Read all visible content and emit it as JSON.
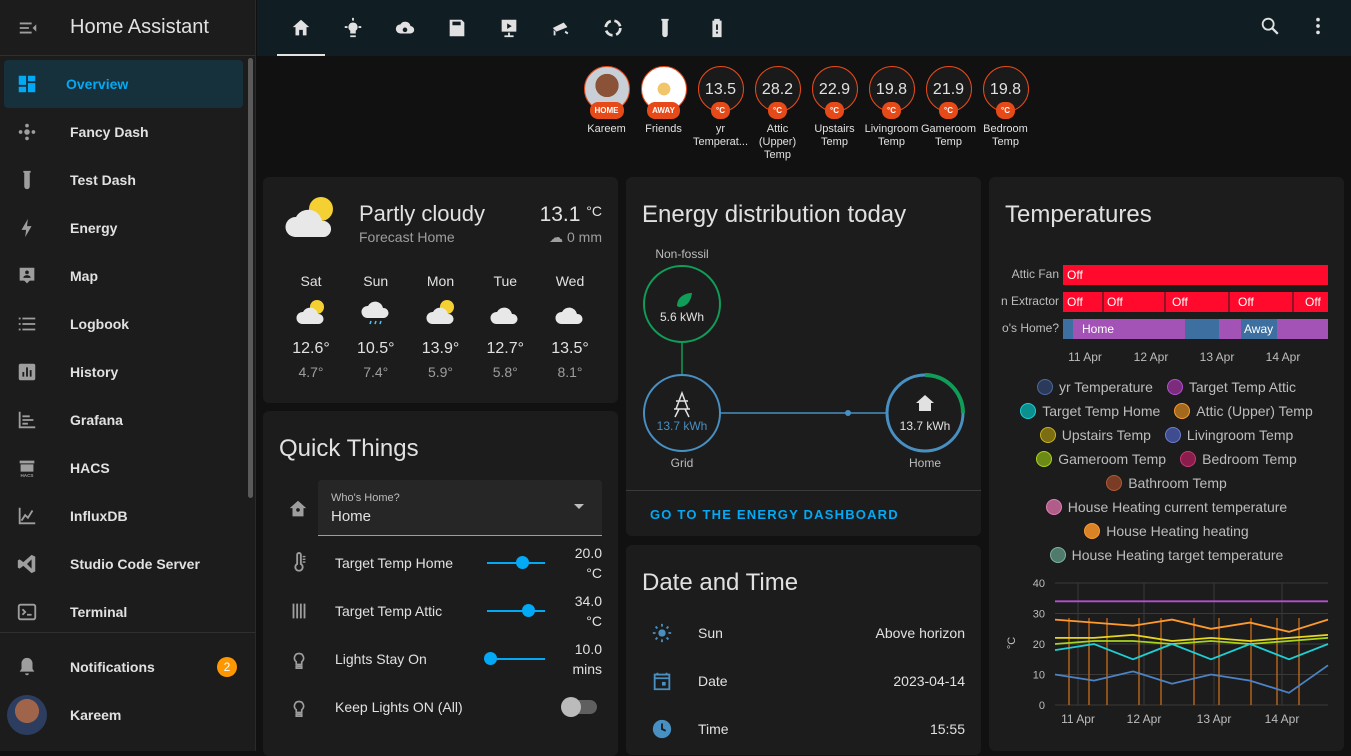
{
  "app": {
    "title": "Home Assistant"
  },
  "sidebar": {
    "items": [
      {
        "label": "Overview",
        "icon": "dashboard-icon"
      },
      {
        "label": "Fancy Dash",
        "icon": "fancy-dash-icon"
      },
      {
        "label": "Test Dash",
        "icon": "test-tube-icon"
      },
      {
        "label": "Energy",
        "icon": "lightning-icon"
      },
      {
        "label": "Map",
        "icon": "map-icon"
      },
      {
        "label": "Logbook",
        "icon": "logbook-icon"
      },
      {
        "label": "History",
        "icon": "history-icon"
      },
      {
        "label": "Grafana",
        "icon": "grafana-icon"
      },
      {
        "label": "HACS",
        "icon": "hacs-icon"
      },
      {
        "label": "InfluxDB",
        "icon": "influxdb-icon"
      },
      {
        "label": "Studio Code Server",
        "icon": "vscode-icon"
      },
      {
        "label": "Terminal",
        "icon": "terminal-icon"
      }
    ],
    "notifications": {
      "label": "Notifications",
      "count": "2"
    },
    "user": {
      "label": "Kareem"
    },
    "hacs_icon_text": "HACS"
  },
  "badges": [
    {
      "name": "Kareem",
      "tag": "HOME",
      "kind": "person"
    },
    {
      "name": "Friends",
      "tag": "AWAY",
      "kind": "group"
    },
    {
      "value": "13.5",
      "unit": "°C",
      "name": "yr Temperat..."
    },
    {
      "value": "28.2",
      "unit": "°C",
      "name": "Attic (Upper) Temp"
    },
    {
      "value": "22.9",
      "unit": "°C",
      "name": "Upstairs Temp"
    },
    {
      "value": "19.8",
      "unit": "°C",
      "name": "Livingroom Temp"
    },
    {
      "value": "21.9",
      "unit": "°C",
      "name": "Gameroom Temp"
    },
    {
      "value": "19.8",
      "unit": "°C",
      "name": "Bedroom Temp"
    }
  ],
  "weather": {
    "condition": "Partly cloudy",
    "subtitle": "Forecast Home",
    "temp": "13.1",
    "unit": "°C",
    "precip": "0 mm",
    "forecast": [
      {
        "day": "Sat",
        "hi": "12.6°",
        "lo": "4.7°",
        "icon": "partly-cloudy-icon"
      },
      {
        "day": "Sun",
        "hi": "10.5°",
        "lo": "7.4°",
        "icon": "rainy-icon"
      },
      {
        "day": "Mon",
        "hi": "13.9°",
        "lo": "5.9°",
        "icon": "partly-cloudy-icon"
      },
      {
        "day": "Tue",
        "hi": "12.7°",
        "lo": "5.8°",
        "icon": "cloudy-icon"
      },
      {
        "day": "Wed",
        "hi": "13.5°",
        "lo": "8.1°",
        "icon": "cloudy-icon"
      }
    ]
  },
  "quick": {
    "title": "Quick Things",
    "whos_home": {
      "label": "Who's Home?",
      "value": "Home"
    },
    "rows": [
      {
        "label": "Target Temp Home",
        "value_line1": "20.0",
        "value_line2": "°C",
        "level": 0.6
      },
      {
        "label": "Target Temp Attic",
        "value_line1": "34.0",
        "value_line2": "°C",
        "level": 0.7
      },
      {
        "label": "Lights Stay On",
        "value_line1": "10.0",
        "value_line2": "mins",
        "level": 0.05
      },
      {
        "label": "Keep Lights ON (All)"
      }
    ]
  },
  "energy": {
    "title": "Energy distribution today",
    "nonfossil": {
      "label": "Non-fossil",
      "value": "5.6 kWh"
    },
    "grid": {
      "label": "Grid",
      "value": "13.7 kWh"
    },
    "home": {
      "label": "Home",
      "value": "13.7 kWh"
    },
    "link": "GO TO THE ENERGY DASHBOARD"
  },
  "datetime": {
    "title": "Date and Time",
    "rows": [
      {
        "label": "Sun",
        "value": "Above horizon"
      },
      {
        "label": "Date",
        "value": "2023-04-14"
      },
      {
        "label": "Time",
        "value": "15:55"
      }
    ]
  },
  "temperatures": {
    "title": "Temperatures",
    "timeline": {
      "rows": [
        "Attic Fan",
        "n Extractor",
        "o's Home?"
      ],
      "attic_fan": [
        "Off"
      ],
      "extractor": [
        "Off",
        "Off",
        "Off",
        "Off",
        "Off"
      ],
      "whos_home": [
        "Home",
        "Away"
      ],
      "dates": [
        "11 Apr",
        "12 Apr",
        "13 Apr",
        "14 Apr"
      ]
    },
    "legend": [
      {
        "name": "yr Temperature",
        "color": "#2b3a5a"
      },
      {
        "name": "Target Temp Attic",
        "color": "#7b2c7d"
      },
      {
        "name": "Target Temp Home",
        "color": "#0b8f8f"
      },
      {
        "name": "Attic (Upper) Temp",
        "color": "#a36a1e"
      },
      {
        "name": "Upstairs Temp",
        "color": "#7a6d12"
      },
      {
        "name": "Livingroom Temp",
        "color": "#3f4c8f"
      },
      {
        "name": "Gameroom Temp",
        "color": "#6e8a16"
      },
      {
        "name": "Bedroom Temp",
        "color": "#8a1d4c"
      },
      {
        "name": "Bathroom Temp",
        "color": "#7a3c24"
      },
      {
        "name": "House Heating current temperature",
        "color": "#b05d8a"
      },
      {
        "name": "House Heating heating",
        "color": "#d98326"
      },
      {
        "name": "House Heating target temperature",
        "color": "#4f7a6c"
      }
    ]
  },
  "chart_data": {
    "type": "line",
    "ylabel": "°C",
    "ylim": [
      0,
      40
    ],
    "yticks": [
      "0",
      "10",
      "20",
      "30",
      "40"
    ],
    "xticks": [
      "11 Apr",
      "12 Apr",
      "13 Apr",
      "14 Apr"
    ],
    "grid": true,
    "series": [
      {
        "name": "Target Temp Attic",
        "color": "#b44fd1",
        "values": [
          34,
          34,
          34,
          34,
          34,
          34,
          34,
          34
        ]
      },
      {
        "name": "Attic (Upper) Temp",
        "color": "#ff9a2e",
        "values": [
          28,
          27,
          26,
          28,
          25,
          27,
          24,
          28
        ]
      },
      {
        "name": "Upstairs Temp",
        "color": "#e8d51e",
        "values": [
          22,
          22,
          23,
          21,
          22,
          21,
          22,
          23
        ]
      },
      {
        "name": "Gameroom Temp",
        "color": "#a6d41e",
        "values": [
          20,
          21,
          21,
          20,
          21,
          20,
          21,
          22
        ]
      },
      {
        "name": "Target Temp Home",
        "color": "#1ed0d6",
        "values": [
          18,
          20,
          15,
          20,
          15,
          20,
          15,
          20
        ]
      },
      {
        "name": "yr Temperature",
        "color": "#4d83c4",
        "values": [
          10,
          8,
          11,
          7,
          10,
          8,
          4,
          13
        ]
      }
    ]
  }
}
